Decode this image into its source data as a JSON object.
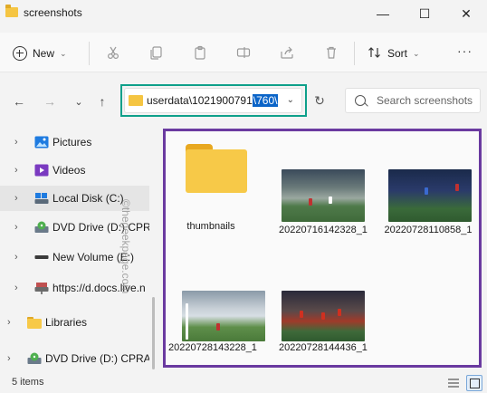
{
  "window": {
    "title": "screenshots",
    "minimize": "—",
    "maximize": "☐",
    "close": "✕"
  },
  "toolbar": {
    "new_label": "New",
    "sort_label": "Sort",
    "more": "···"
  },
  "address": {
    "path_prefix": "userdata\\1021900791",
    "path_selected": "\\760\\",
    "search_placeholder": "Search screenshots"
  },
  "sidebar": {
    "items": [
      {
        "label": "Pictures",
        "icon": "pictures-icon"
      },
      {
        "label": "Videos",
        "icon": "videos-icon"
      },
      {
        "label": "Local Disk (C:)",
        "icon": "local-disk-icon"
      },
      {
        "label": "DVD Drive (D:) CPRA",
        "icon": "dvd-drive-icon"
      },
      {
        "label": "New Volume (E:)",
        "icon": "drive-icon"
      },
      {
        "label": "https://d.docs.live.n",
        "icon": "network-drive-icon"
      },
      {
        "label": "Libraries",
        "icon": "libraries-folder-icon"
      },
      {
        "label": "DVD Drive (D:) CPRA_",
        "icon": "dvd-drive-icon"
      }
    ]
  },
  "content": {
    "items": [
      {
        "label": "thumbnails",
        "type": "folder"
      },
      {
        "label": "20220716142328_1",
        "type": "image"
      },
      {
        "label": "20220728110858_1",
        "type": "image"
      },
      {
        "label": "20220728143228_1",
        "type": "image"
      },
      {
        "label": "20220728144436_1",
        "type": "image"
      }
    ]
  },
  "status": {
    "count_text": "5 items"
  },
  "watermark": "©thegeekpage.com",
  "colors": {
    "address_highlight": "#0ea08a",
    "content_highlight": "#6a3aa0",
    "selection": "#0a64c8",
    "folder": "#f7c948"
  }
}
